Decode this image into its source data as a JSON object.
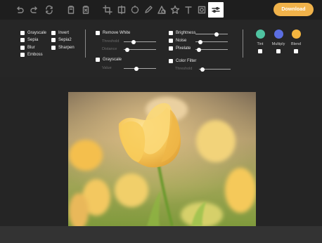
{
  "toolbar": {
    "tools": [
      {
        "icon": "undo-icon"
      },
      {
        "icon": "redo-icon"
      },
      {
        "icon": "reset-icon"
      },
      {
        "icon": "delete-icon"
      },
      {
        "icon": "delete-all-icon"
      },
      {
        "icon": "crop-icon"
      },
      {
        "icon": "flip-icon"
      },
      {
        "icon": "rotate-icon"
      },
      {
        "icon": "draw-icon"
      },
      {
        "icon": "shape-icon"
      },
      {
        "icon": "icon-tool-icon"
      },
      {
        "icon": "text-icon"
      },
      {
        "icon": "mask-icon"
      },
      {
        "icon": "filter-icon",
        "active": true
      }
    ],
    "download_label": "Download"
  },
  "filters": {
    "col1": [
      "Grayscale",
      "Sepia",
      "Blur",
      "Emboss"
    ],
    "col2": [
      "Invert",
      "Sepia2",
      "Sharpen"
    ],
    "remove_white": {
      "label": "Remove White",
      "threshold_label": "Threshold",
      "distance_label": "Distance",
      "threshold": 0.3,
      "distance": 0.1
    },
    "grayscale2": {
      "label": "Grayscale",
      "value_label": "Value",
      "value": 0.4
    },
    "brightness": {
      "label": "Brightness",
      "value": 0.65
    },
    "noise": {
      "label": "Noise",
      "value": 0.15
    },
    "pixelate": {
      "label": "Pixelate",
      "value": 0.1
    },
    "color_filter": {
      "label": "Color Filter",
      "threshold_label": "Threshold",
      "threshold": 0.12
    },
    "colors": [
      {
        "label": "Tint",
        "color": "#4fc3a1"
      },
      {
        "label": "Multiply",
        "color": "#5b6ee1"
      },
      {
        "label": "Blend",
        "color": "#f3b53f"
      }
    ]
  }
}
